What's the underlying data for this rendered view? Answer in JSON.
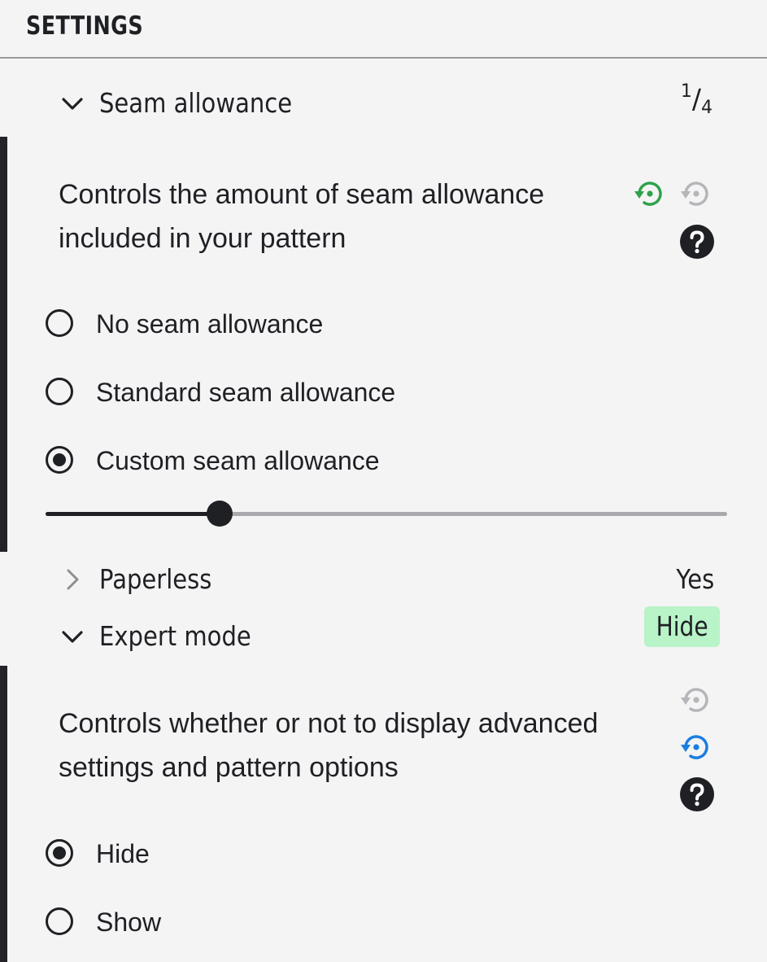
{
  "panel": {
    "title": "SETTINGS"
  },
  "seam_allowance": {
    "label": "Seam allowance",
    "value_numerator": "1",
    "value_slash": "/",
    "value_denominator": "4",
    "expanded": true,
    "description": "Controls the amount of seam allowance included in your pattern",
    "reset_icons": [
      "reset-default-icon",
      "reset-previous-icon",
      "help-icon"
    ],
    "options": [
      {
        "label": "No seam allowance",
        "checked": false
      },
      {
        "label": "Standard seam allowance",
        "checked": false
      },
      {
        "label": "Custom seam allowance",
        "checked": true
      }
    ],
    "slider_level": 0.255
  },
  "paperless": {
    "label": "Paperless",
    "value": "Yes",
    "expanded": false
  },
  "expert_mode": {
    "label": "Expert mode",
    "value": "Hide",
    "expanded": true,
    "description": "Controls whether or not to display advanced settings and pattern options",
    "options": [
      {
        "label": "Hide",
        "checked": true
      },
      {
        "label": "Show",
        "checked": false
      }
    ]
  },
  "colors": {
    "dark": "#1f2024",
    "accent_green": "#2ea24a",
    "accent_blue": "#1a7ee0",
    "muted_gray": "#b6b6ba",
    "pill_green": "#b9f3c8",
    "background": "#f4f4f5"
  }
}
